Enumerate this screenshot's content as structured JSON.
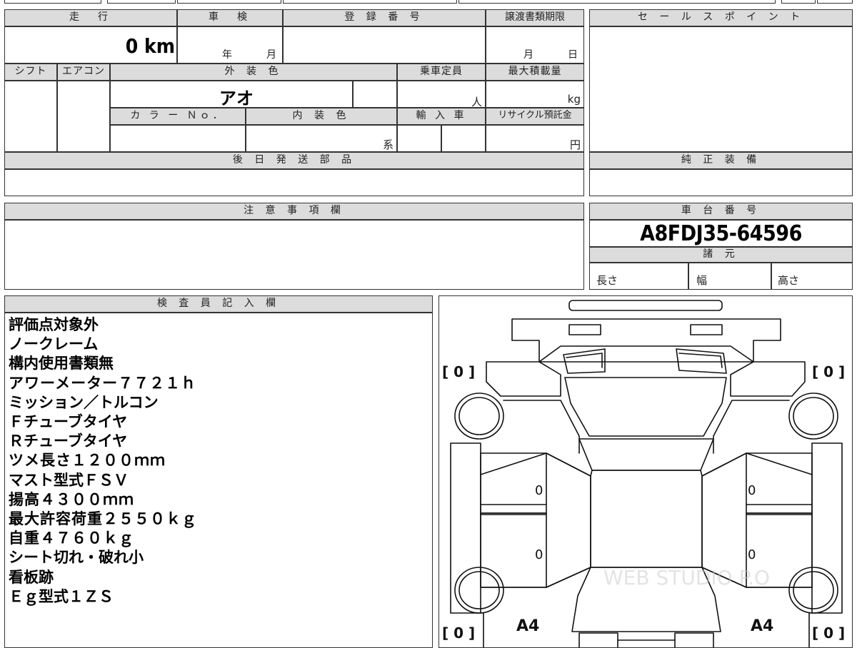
{
  "top_section": {
    "mileage_header": "走　行",
    "mileage_value": "0 km",
    "shaken_header": "車　検",
    "shaken_year_unit": "年",
    "shaken_month_unit": "月",
    "registration_header": "登 録 番 号",
    "transfer_header": "譲渡書類期限",
    "transfer_month_unit": "月",
    "transfer_day_unit": "日",
    "shift_header": "シフト",
    "aircon_header": "エアコン",
    "exterior_color_header": "外 装 色",
    "exterior_color_value": "アオ",
    "capacity_header": "乗車定員",
    "capacity_unit": "人",
    "max_load_header": "最大積載量",
    "max_load_unit": "kg",
    "color_no_header": "カ ラ ー Ｎｏ．",
    "interior_color_header": "内 装 色",
    "interior_color_unit": "系",
    "import_header": "輸 入 車",
    "recycle_header": "リサイクル預託金",
    "recycle_unit": "円",
    "later_parts_header": "後 日 発 送 部 品"
  },
  "right_section": {
    "sales_point_header": "セ ー ル ス ポ イ ン ト",
    "genuine_equipment_header": "純 正 装 備",
    "chassis_number_header": "車 台 番 号",
    "chassis_number_value": "A8FDJ35-64596",
    "specs_header": "諸 元",
    "length_label": "長さ",
    "width_label": "幅",
    "height_label": "高さ"
  },
  "notice": {
    "header": "注 意 事 項 欄"
  },
  "inspector": {
    "header": "検 査 員 記 入 欄",
    "notes": [
      "評価点対象外",
      "ノークレーム",
      "構内使用書類無",
      "アワーメーター７７２１ｈ",
      "ミッション／トルコン",
      "Ｆチューブタイヤ",
      "Ｒチューブタイヤ",
      "ツメ長さ１２００ｍｍ",
      "マスト型式ＦＳＶ",
      "揚高４３００ｍｍ",
      "最大許容荷重２５５０ｋｇ",
      "自重４７６０ｋｇ",
      "シート切れ・破れ小",
      "看板跡",
      "Ｅｇ型式１ＺＳ"
    ]
  },
  "diagram": {
    "tire_front_left": "[ 0 ]",
    "tire_front_right": "[ 0 ]",
    "tire_rear_left": "[ 0 ]",
    "tire_rear_right": "[ 0 ]",
    "left_door_front": "0",
    "left_door_rear": "0",
    "right_door_front": "0",
    "right_door_rear": "0",
    "left_rear_mark": "A4",
    "right_rear_mark": "A4",
    "watermark": "WEB STUDIO P.O"
  }
}
